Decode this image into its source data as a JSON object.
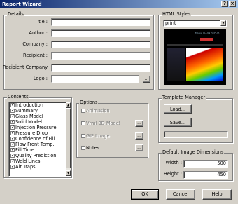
{
  "window": {
    "title": "Report Wizard",
    "help_btn": "?",
    "close_btn": "×"
  },
  "details": {
    "legend": "Details",
    "fields": [
      {
        "label": "Title :",
        "value": ""
      },
      {
        "label": "Author :",
        "value": ""
      },
      {
        "label": "Company :",
        "value": ""
      },
      {
        "label": "Recipient :",
        "value": ""
      },
      {
        "label": "Recipient Company :",
        "value": ""
      },
      {
        "label": "Logo :",
        "value": ""
      }
    ],
    "logo_browse": "..."
  },
  "html_styles": {
    "legend": "HTML Styles",
    "selected": "print",
    "preview_heading": "MOLD FLOW REPORT"
  },
  "contents": {
    "legend": "Contents",
    "items": [
      {
        "label": "Introduction",
        "checked": "✓"
      },
      {
        "label": "Summary",
        "checked": "✓"
      },
      {
        "label": "Glass Model",
        "checked": "✓"
      },
      {
        "label": "Solid Model",
        "checked": "✓"
      },
      {
        "label": "Injection Pressure",
        "checked": "✓"
      },
      {
        "label": "Pressure Drop",
        "checked": "✓"
      },
      {
        "label": "Confidence of Fill",
        "checked": "✓"
      },
      {
        "label": "Flow Front Temp.",
        "checked": "✓"
      },
      {
        "label": "Fill Time",
        "checked": "✓"
      },
      {
        "label": "Quality Prediction",
        "checked": "✓"
      },
      {
        "label": "Weld Lines",
        "checked": "✓"
      },
      {
        "label": "Air Traps",
        "checked": "✓"
      }
    ]
  },
  "options": {
    "legend": "Options",
    "items": [
      {
        "label": "Animation",
        "has_button": false
      },
      {
        "label": "Vrml 3D Model",
        "has_button": true
      },
      {
        "label": "GIF Image",
        "has_button": true
      },
      {
        "label": "Notes",
        "has_button": true
      }
    ],
    "browse": "..."
  },
  "template_manager": {
    "legend": "Template Manager",
    "load": "Load...",
    "save": "Save...",
    "path": ""
  },
  "image_dims": {
    "legend": "Default Image Dimensions",
    "width_label": "Width :",
    "width_value": "500",
    "height_label": "Height :",
    "height_value": "450"
  },
  "footer": {
    "ok": "OK",
    "cancel": "Cancel",
    "help": "Help"
  }
}
